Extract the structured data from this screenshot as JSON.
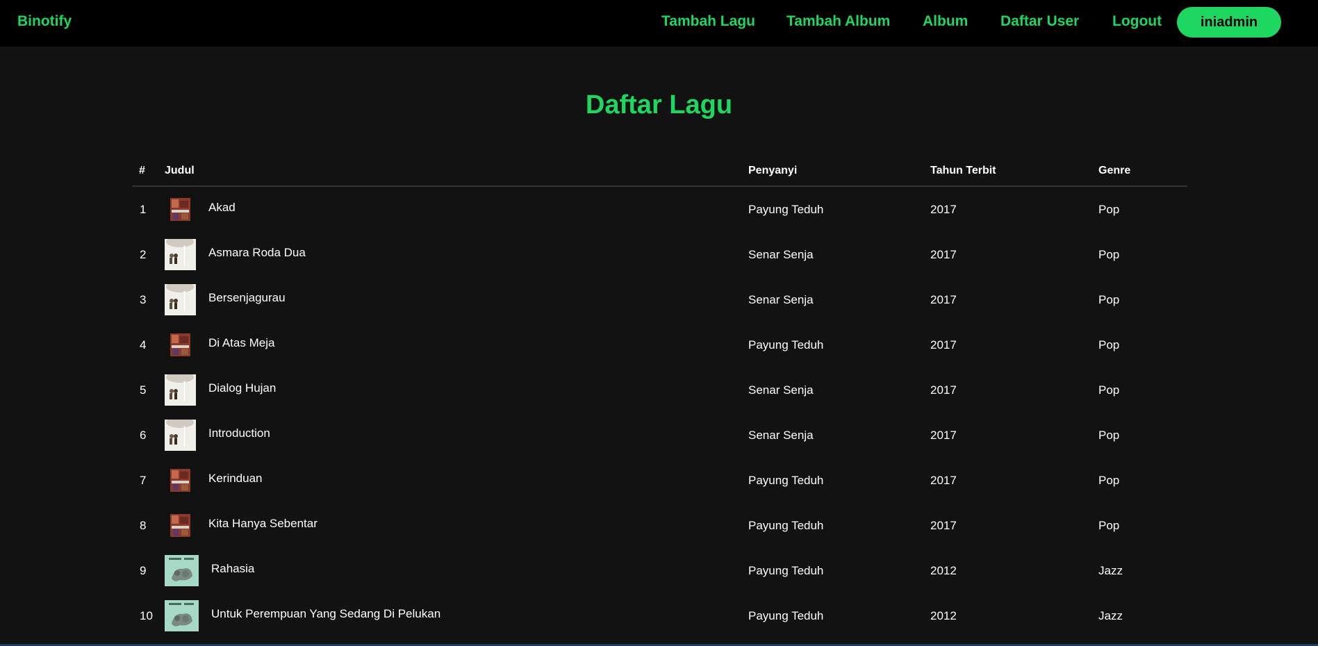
{
  "navbar": {
    "brand": "Binotify",
    "links": [
      "Tambah Lagu",
      "Tambah Album",
      "Album",
      "Daftar User",
      "Logout"
    ],
    "user": "iniadmin"
  },
  "page": {
    "title": "Daftar Lagu"
  },
  "table": {
    "headers": {
      "num": "#",
      "title": "Judul",
      "singer": "Penyanyi",
      "year": "Tahun Terbit",
      "genre": "Genre"
    },
    "rows": [
      {
        "num": "1",
        "title": "Akad",
        "singer": "Payung Teduh",
        "year": "2017",
        "genre": "Pop",
        "cover": "album-cover-red"
      },
      {
        "num": "2",
        "title": "Asmara Roda Dua",
        "singer": "Senar Senja",
        "year": "2017",
        "genre": "Pop",
        "cover": "album-cover-white"
      },
      {
        "num": "3",
        "title": "Bersenjagurau",
        "singer": "Senar Senja",
        "year": "2017",
        "genre": "Pop",
        "cover": "album-cover-white"
      },
      {
        "num": "4",
        "title": "Di Atas Meja",
        "singer": "Payung Teduh",
        "year": "2017",
        "genre": "Pop",
        "cover": "album-cover-red"
      },
      {
        "num": "5",
        "title": "Dialog Hujan",
        "singer": "Senar Senja",
        "year": "2017",
        "genre": "Pop",
        "cover": "album-cover-white"
      },
      {
        "num": "6",
        "title": "Introduction",
        "singer": "Senar Senja",
        "year": "2017",
        "genre": "Pop",
        "cover": "album-cover-white"
      },
      {
        "num": "7",
        "title": "Kerinduan",
        "singer": "Payung Teduh",
        "year": "2017",
        "genre": "Pop",
        "cover": "album-cover-red"
      },
      {
        "num": "8",
        "title": "Kita Hanya Sebentar",
        "singer": "Payung Teduh",
        "year": "2017",
        "genre": "Pop",
        "cover": "album-cover-red"
      },
      {
        "num": "9",
        "title": "Rahasia",
        "singer": "Payung Teduh",
        "year": "2012",
        "genre": "Jazz",
        "cover": "album-cover-green"
      },
      {
        "num": "10",
        "title": "Untuk Perempuan Yang Sedang Di Pelukan",
        "singer": "Payung Teduh",
        "year": "2012",
        "genre": "Jazz",
        "cover": "album-cover-green"
      }
    ]
  },
  "colors": {
    "accent": "#1ed760",
    "background": "#121212",
    "navbar": "#000000"
  }
}
